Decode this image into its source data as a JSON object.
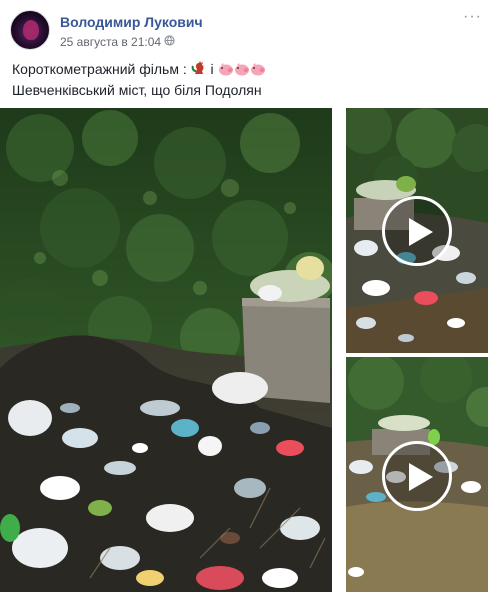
{
  "post": {
    "author": "Володимир Лукович",
    "timestamp": "25 августа в 21:04",
    "text_line1_prefix": "Короткометражний фільм : ",
    "text_line1_mid": " і ",
    "text_line2": "Шевченківський міст, що біля Подолян",
    "icons": [
      "rooster-emoji",
      "pig-emoji",
      "pig-emoji",
      "pig-emoji"
    ]
  },
  "media": {
    "main_photo": "garbage-dump-photo",
    "videos": [
      {
        "name": "video-1",
        "play_icon": "play-icon"
      },
      {
        "name": "video-2",
        "play_icon": "play-icon"
      }
    ]
  },
  "colors": {
    "author": "#385898",
    "meta": "#616770",
    "text": "#1d2129",
    "background": "#ffffff"
  }
}
